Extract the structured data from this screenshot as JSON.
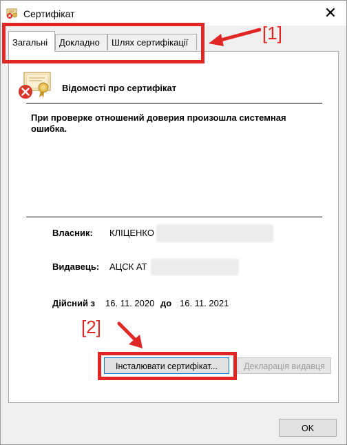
{
  "window": {
    "title": "Сертифікат",
    "close_symbol": "✕"
  },
  "tabs": [
    {
      "label": "Загальні",
      "active": true
    },
    {
      "label": "Докладно",
      "active": false
    },
    {
      "label": "Шлях сертифікації",
      "active": false
    }
  ],
  "certificate": {
    "heading": "Відомості про сертифікат",
    "icon": "certificate-error-icon",
    "error_message": "При проверке отношений доверия произошла системная ошибка.",
    "owner_label": "Власник:",
    "owner_value": "КЛІЦЕНКО",
    "issuer_label": "Видавець:",
    "issuer_value": "АЦСК АТ",
    "valid_from_label": "Дійсний з",
    "valid_from": "16. 11. 2020",
    "valid_to_label": "до",
    "valid_to": "16. 11. 2021"
  },
  "buttons": {
    "install": "Інсталювати сертифікат...",
    "declaration": "Декларація видавця",
    "ok": "OK"
  },
  "annotations": {
    "label1": "[1]",
    "label2": "[2]",
    "color": "#e12726"
  }
}
